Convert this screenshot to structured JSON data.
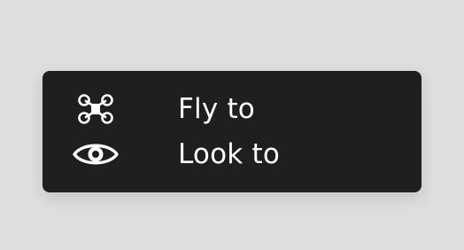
{
  "menu": {
    "items": [
      {
        "label": "Fly to",
        "icon": "drone-icon"
      },
      {
        "label": "Look to",
        "icon": "eye-icon"
      }
    ]
  },
  "colors": {
    "background": "#dedede",
    "menu_background": "#1f1f1f",
    "text": "#ffffff"
  }
}
